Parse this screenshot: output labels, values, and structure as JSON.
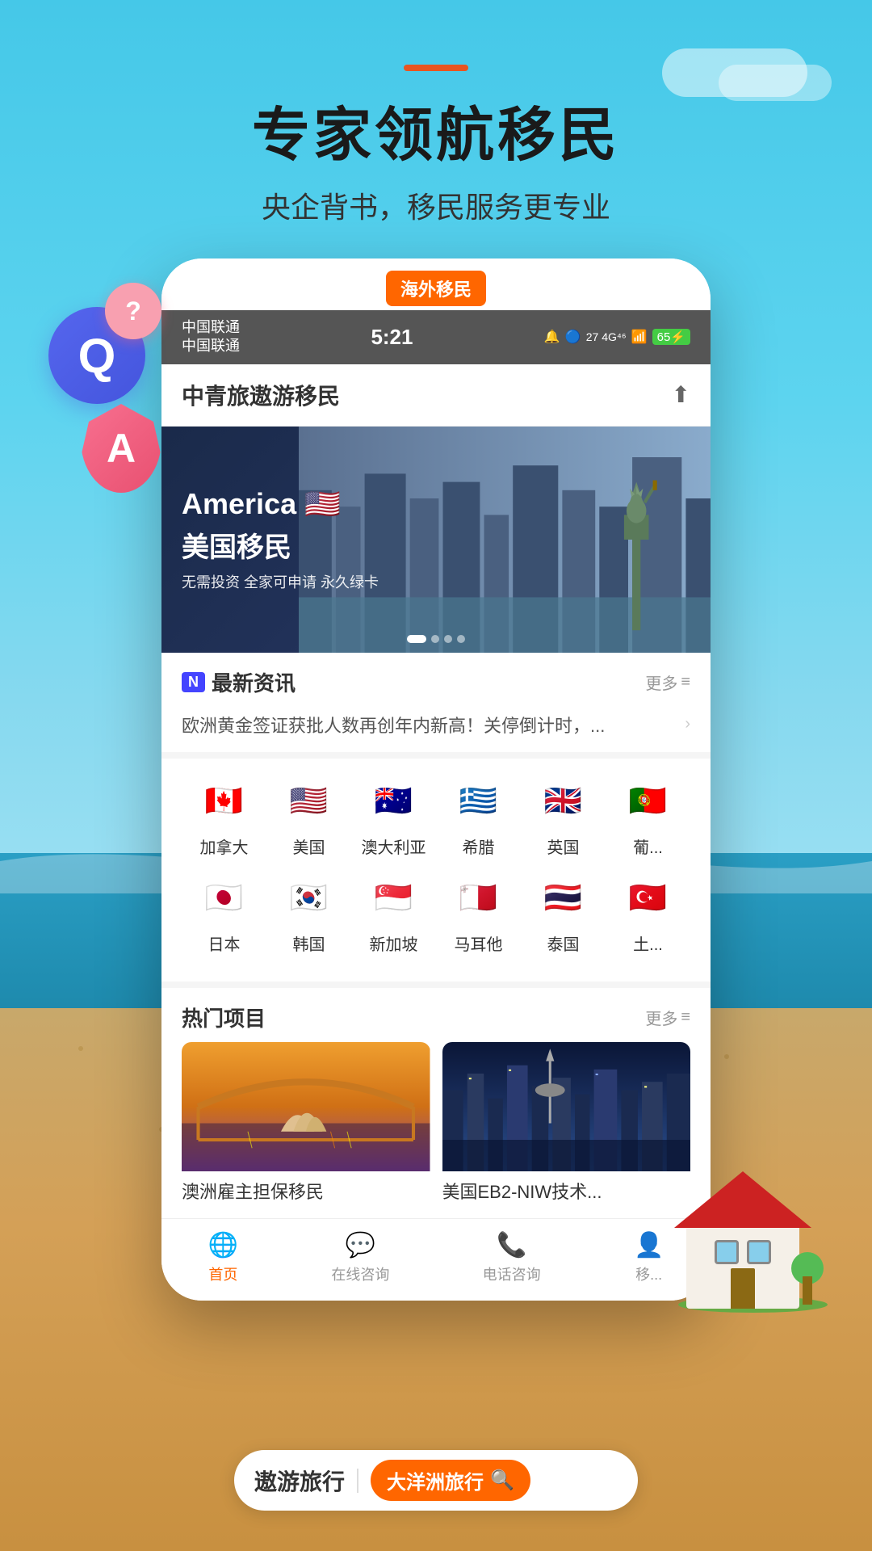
{
  "background": {
    "type": "beach-sky"
  },
  "header": {
    "accent_line": "orange-bar",
    "main_title": "专家领航移民",
    "sub_title": "央企背书，移民服务更专业"
  },
  "qa_decoration": {
    "q_label": "Q",
    "a_label": "A",
    "question_mark": "?"
  },
  "overseas_badge": {
    "label": "海外移民"
  },
  "status_bar": {
    "carrier1": "中国联通",
    "carrier2": "中国联通",
    "time": "5:21",
    "icons": "🔔🔵₂⁷ 4G⁴⁶ 65"
  },
  "app_header": {
    "title": "中青旅遨游移民",
    "share_icon": "share"
  },
  "banner": {
    "en_text": "America 🇺🇸",
    "zh_text": "美国移民",
    "desc": "无需投资 全家可申请 永久绿卡",
    "dots": [
      "active",
      "inactive",
      "inactive",
      "inactive"
    ]
  },
  "news_section": {
    "badge": "N",
    "title": "最新资讯",
    "more": "更多",
    "news_text": "欧洲黄金签证获批人数再创年内新高！关停倒计时，..."
  },
  "countries": {
    "row1": [
      {
        "name": "加拿大",
        "flag": "🇨🇦"
      },
      {
        "name": "美国",
        "flag": "🇺🇸"
      },
      {
        "name": "澳大利亚",
        "flag": "🇦🇺"
      },
      {
        "name": "希腊",
        "flag": "🇬🇷"
      },
      {
        "name": "英国",
        "flag": "🇬🇧"
      },
      {
        "name": "葡...",
        "flag": "🇵🇹"
      }
    ],
    "row2": [
      {
        "name": "日本",
        "flag": "🇯🇵"
      },
      {
        "name": "韩国",
        "flag": "🇰🇷"
      },
      {
        "name": "新加坡",
        "flag": "🇸🇬"
      },
      {
        "name": "马耳他",
        "flag": "🇲🇹"
      },
      {
        "name": "泰国",
        "flag": "🇹🇭"
      },
      {
        "name": "土...",
        "flag": "🇹🇷"
      }
    ]
  },
  "hot_projects": {
    "title": "热门项目",
    "more": "更多",
    "items": [
      {
        "title": "澳洲雇主担保移民",
        "img_desc": "Sydney Opera House and Bridge"
      },
      {
        "title": "美国EB2-NIW技术...",
        "img_desc": "Seattle Space Needle skyline"
      }
    ]
  },
  "bottom_nav": {
    "items": [
      {
        "label": "首页",
        "icon": "globe",
        "active": true
      },
      {
        "label": "在线咨询",
        "icon": "chat",
        "active": false
      },
      {
        "label": "电话咨询",
        "icon": "phone",
        "active": false
      },
      {
        "label": "移...",
        "icon": "person",
        "active": false
      }
    ]
  },
  "bottom_search": {
    "brand": "遨游旅行",
    "query": "大洋洲旅行",
    "search_icon": "search"
  }
}
